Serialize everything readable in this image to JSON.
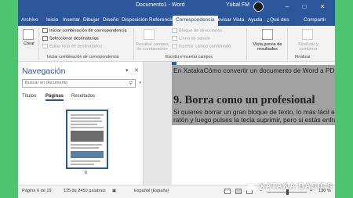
{
  "window": {
    "title": "Documento1 - Word",
    "user": "Yúbal FM",
    "controls": [
      "–",
      "□",
      "✕"
    ]
  },
  "ribbon_tabs": [
    {
      "label": "Archivo",
      "active": false
    },
    {
      "label": "Inicio",
      "active": false
    },
    {
      "label": "Insertar",
      "active": false
    },
    {
      "label": "Dibujar",
      "active": false
    },
    {
      "label": "Diseño",
      "active": false
    },
    {
      "label": "Disposición",
      "active": false
    },
    {
      "label": "Referencias",
      "active": false
    },
    {
      "label": "Correspondencia",
      "active": true
    },
    {
      "label": "Revisar",
      "active": false
    },
    {
      "label": "Vista",
      "active": false
    },
    {
      "label": "Ayuda",
      "active": false
    },
    {
      "label": "¿Qué des",
      "active": false
    },
    {
      "label": "Compartir",
      "active": false
    }
  ],
  "ribbon": {
    "crear": "Crear",
    "iniciar_combinacion": "Iniciar combinación de correspondencia",
    "seleccionar_destinatarios": "Seleccionar destinatarios",
    "editar_lista": "Editar lista de destinatarios",
    "group_iniciar": "Iniciar combinación de correspondencia",
    "resaltar_campos": "Resaltar campos de combinación",
    "bloque_direcciones": "Bloque de direcciones",
    "linea_saludo": "Línea de saludo",
    "insertar_campo": "Insertar campo combinado",
    "group_escribir": "Escribir e insertar campos",
    "vista_previa": "Vista previa de resultados",
    "finalizar": "Finalizar y combinar",
    "group_finalizar": "Finalizar"
  },
  "nav_pane": {
    "title": "Navegación",
    "search_placeholder": "Buscar en documento",
    "tabs": [
      {
        "label": "Títulos",
        "active": false
      },
      {
        "label": "Páginas",
        "active": true
      },
      {
        "label": "Resultados",
        "active": false
      }
    ],
    "thumbnail_page": "6"
  },
  "document": {
    "line1": "En XatakaCómo convertir un documento de Word a PDF",
    "heading": "9. Borra como un profesional",
    "line2": "Si quieres borrar un gran bloque de texto, lo más fácil es",
    "line3": "ratón y luego pulses la tecla suprimir, pero si estás enfras"
  },
  "status": {
    "page": "Página 6 de 19",
    "words": "115 de 2450 palabras",
    "language": "Español (España)",
    "zoom": "130 %"
  },
  "watermark": "XATAKA BASICS",
  "colors": {
    "accent": "#2b579a",
    "background": "#4cc470",
    "selection": "#a2a2a2"
  }
}
